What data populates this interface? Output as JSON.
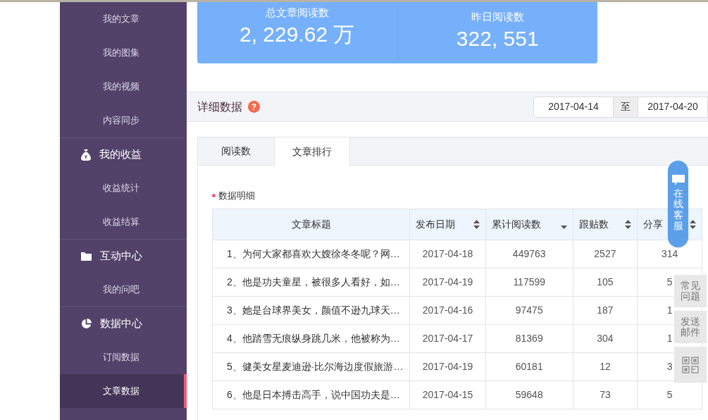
{
  "sidebar": {
    "items": [
      {
        "kind": "sub",
        "label": "我的文章",
        "selected": false
      },
      {
        "kind": "sub",
        "label": "我的图集",
        "selected": false
      },
      {
        "kind": "sub",
        "label": "我的视频",
        "selected": false
      },
      {
        "kind": "sub",
        "label": "内容同步",
        "selected": false
      },
      {
        "kind": "group",
        "label": "我的收益"
      },
      {
        "kind": "sub",
        "label": "收益统计",
        "selected": false
      },
      {
        "kind": "sub",
        "label": "收益结算",
        "selected": false
      },
      {
        "kind": "group",
        "label": "互动中心"
      },
      {
        "kind": "sub",
        "label": "我的问吧",
        "selected": false
      },
      {
        "kind": "group",
        "label": "数据中心"
      },
      {
        "kind": "sub",
        "label": "订阅数据",
        "selected": false
      },
      {
        "kind": "sub",
        "label": "文章数据",
        "selected": true
      }
    ]
  },
  "stats": [
    {
      "label": "总文章阅读数",
      "value": "2, 229.62 万"
    },
    {
      "label": "昨日阅读数",
      "value": "322, 551"
    }
  ],
  "detail": {
    "title": "详细数据",
    "help": "?",
    "date_from": "2017-04-14",
    "separator": "至",
    "date_to": "2017-04-20"
  },
  "tabs": [
    {
      "label": "阅读数",
      "selected": false
    },
    {
      "label": "文章排行",
      "selected": true
    }
  ],
  "section_title": "数据明细",
  "table": {
    "columns": [
      {
        "label": "文章标题",
        "kind": "plain"
      },
      {
        "label": "发布日期",
        "kind": "sortable"
      },
      {
        "label": "累计阅读数",
        "kind": "sorted"
      },
      {
        "label": "跟贴数",
        "kind": "sortable"
      },
      {
        "label": "分享",
        "kind": "sortable"
      }
    ],
    "rows": [
      {
        "cells": [
          "1、为何大家都喜欢大嫂徐冬冬呢？网…",
          "2017-04-18",
          "449763",
          "2527",
          "314"
        ]
      },
      {
        "cells": [
          "2、他是功夫童星，被很多人看好，如…",
          "2017-04-19",
          "117599",
          "105",
          "5"
        ]
      },
      {
        "cells": [
          "3、她是台球界美女，颜值不逊九球天…",
          "2017-04-16",
          "97475",
          "187",
          "1"
        ]
      },
      {
        "cells": [
          "4、他踏雪无痕纵身跳几米，他被称为…",
          "2017-04-17",
          "81369",
          "304",
          "1"
        ]
      },
      {
        "cells": [
          "5、健美女星麦迪逊·比尔海边度假旅游…",
          "2017-04-19",
          "60181",
          "12",
          "3"
        ]
      },
      {
        "cells": [
          "6、他是日本搏击高手，说中国功夫是…",
          "2017-04-15",
          "59648",
          "73",
          "5"
        ]
      }
    ]
  },
  "float": {
    "service": "在线客服",
    "faq": "常见问题",
    "mail": "发送邮件"
  }
}
